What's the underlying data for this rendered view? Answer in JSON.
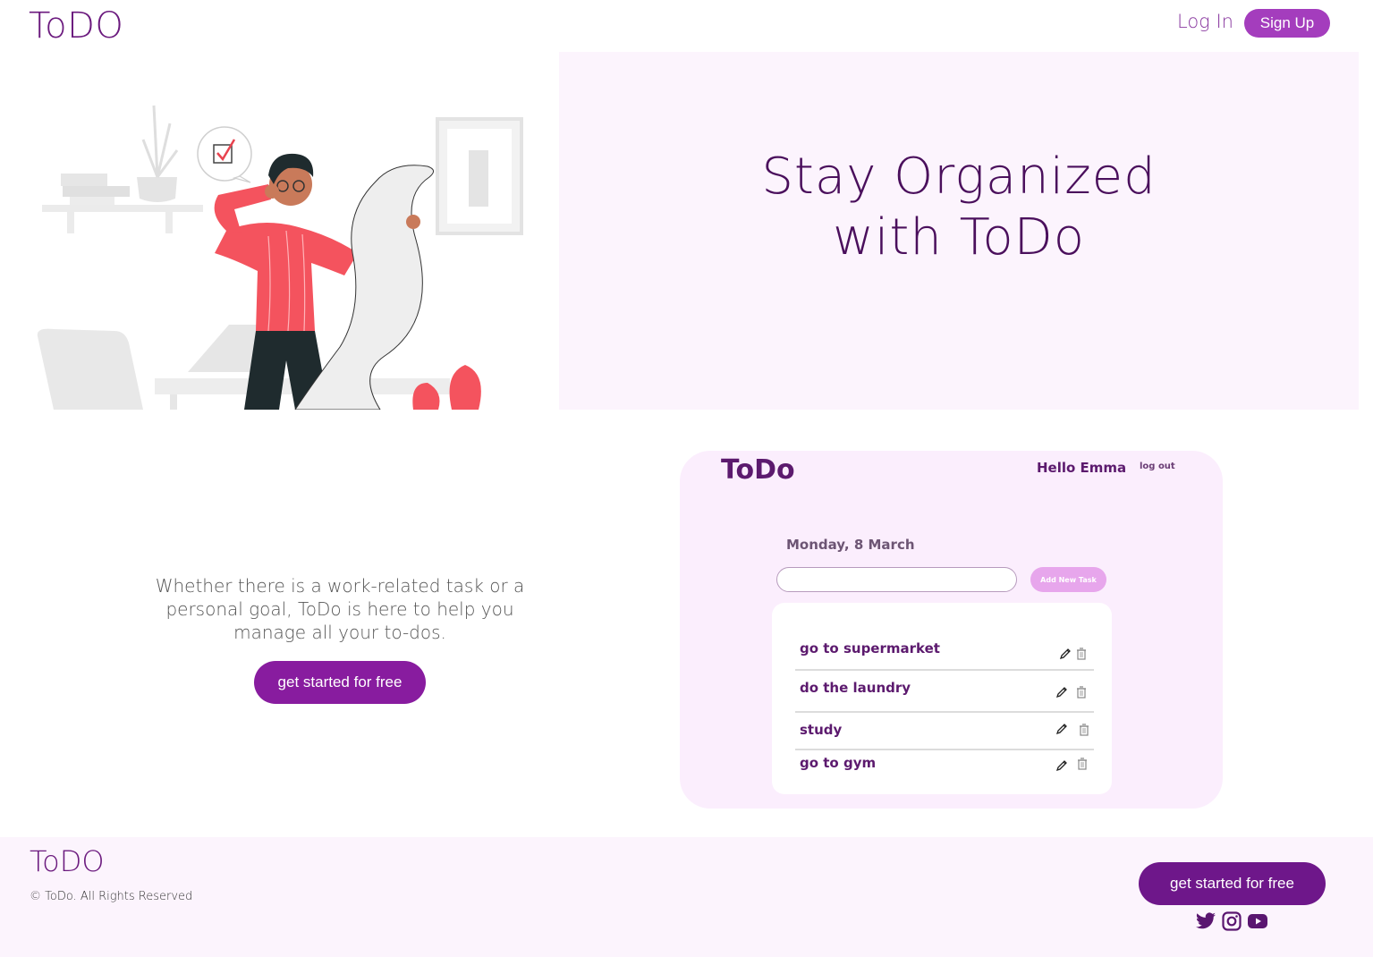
{
  "header": {
    "logo": "ToDO",
    "login_label": "Log In",
    "signup_label": "Sign Up"
  },
  "hero": {
    "title_line1": "Stay Organized",
    "title_line2": "with ToDo",
    "illustration": "person-reading-todo-list-illustration"
  },
  "pitch": {
    "text": "Whether there is a work-related task or a personal goal, ToDo is here to help you manage all your to-dos.",
    "cta_label": "get started for free"
  },
  "preview": {
    "logo": "ToDo",
    "greeting": "Hello Emma",
    "logout_label": "log out",
    "date": "Monday, 8 March",
    "input_value": "",
    "add_label": "Add New Task",
    "tasks": [
      {
        "label": "go to supermarket"
      },
      {
        "label": "do the laundry"
      },
      {
        "label": "study"
      },
      {
        "label": "go to gym"
      }
    ]
  },
  "footer": {
    "logo": "ToDO",
    "copyright": "© ToDo. All Rights Reserved",
    "cta_label": "get started for free",
    "social": [
      "twitter-icon",
      "instagram-icon",
      "youtube-icon"
    ]
  },
  "colors": {
    "brand": "#6b1a7e",
    "cta": "#881c9f",
    "accent": "#a43dbd",
    "panel": "#fcf4fd"
  }
}
